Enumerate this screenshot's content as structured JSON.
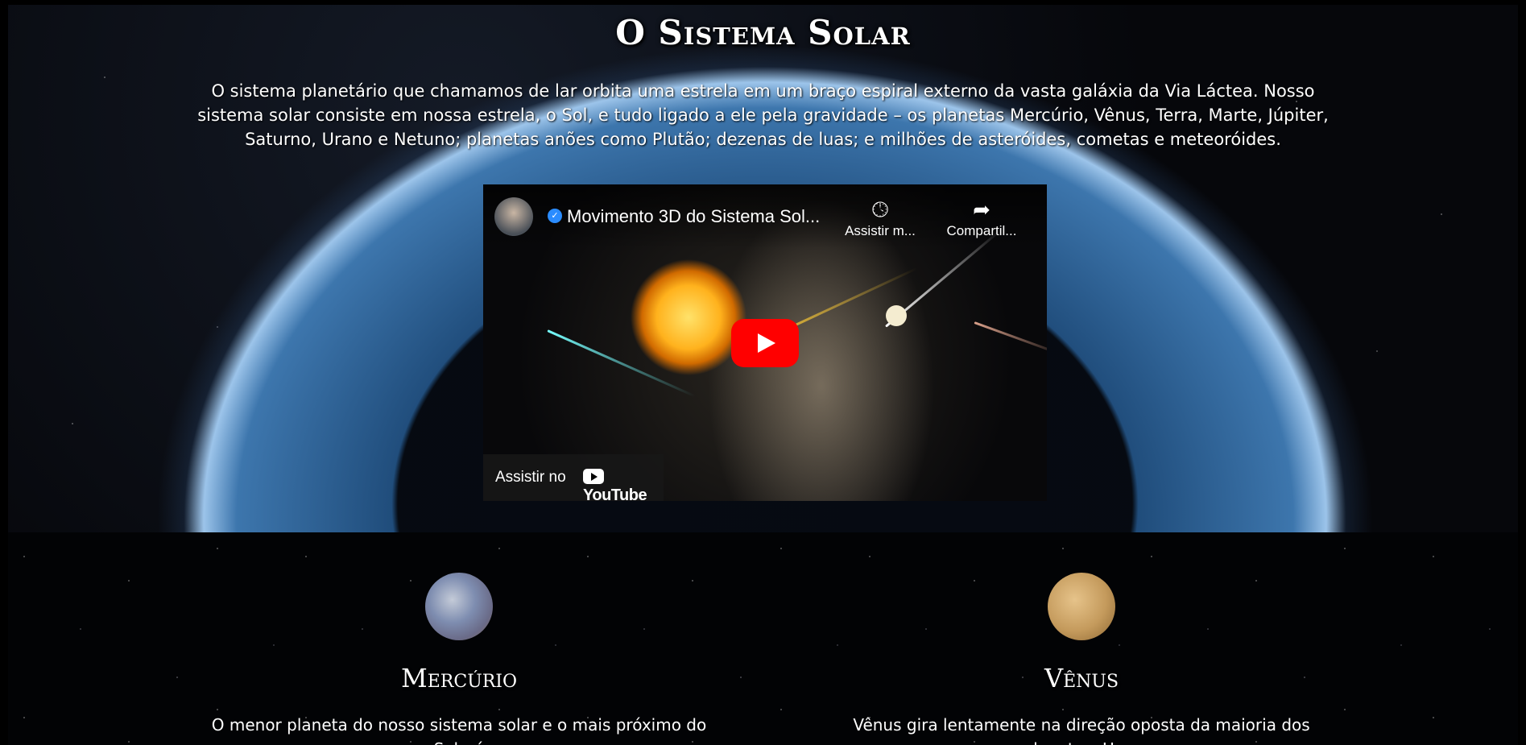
{
  "page": {
    "title": "O Sistema Solar",
    "intro": "O sistema planetário que chamamos de lar orbita uma estrela em um braço espiral externo da vasta galáxia da Via Láctea. Nosso sistema solar consiste em nossa estrela, o Sol, e tudo ligado a ele pela gravidade – os planetas Mercúrio, Vênus, Terra, Marte, Júpiter, Saturno, Urano e Netuno; planetas anões como Plutão; dezenas de luas; e milhões de asteróides, cometas e meteoróides."
  },
  "video": {
    "title": "Movimento 3D do Sistema Sol...",
    "watch_later_label": "Assistir m...",
    "share_label": "Compartil...",
    "watch_on_label": "Assistir no",
    "youtube_label": "YouTube",
    "icons": [
      "clock-icon",
      "share-arrow-icon",
      "play-icon",
      "verified-icon"
    ]
  },
  "planets": [
    {
      "name": "Mercúrio",
      "description": "O menor planeta do nosso sistema solar e o mais próximo do Sol - é"
    },
    {
      "name": "Vênus",
      "description": "Vênus gira lentamente na direção oposta da maioria dos planetas. Uma"
    }
  ],
  "colors": {
    "youtube_red": "#ff0000",
    "background": "#000000",
    "text": "#ffffff"
  }
}
